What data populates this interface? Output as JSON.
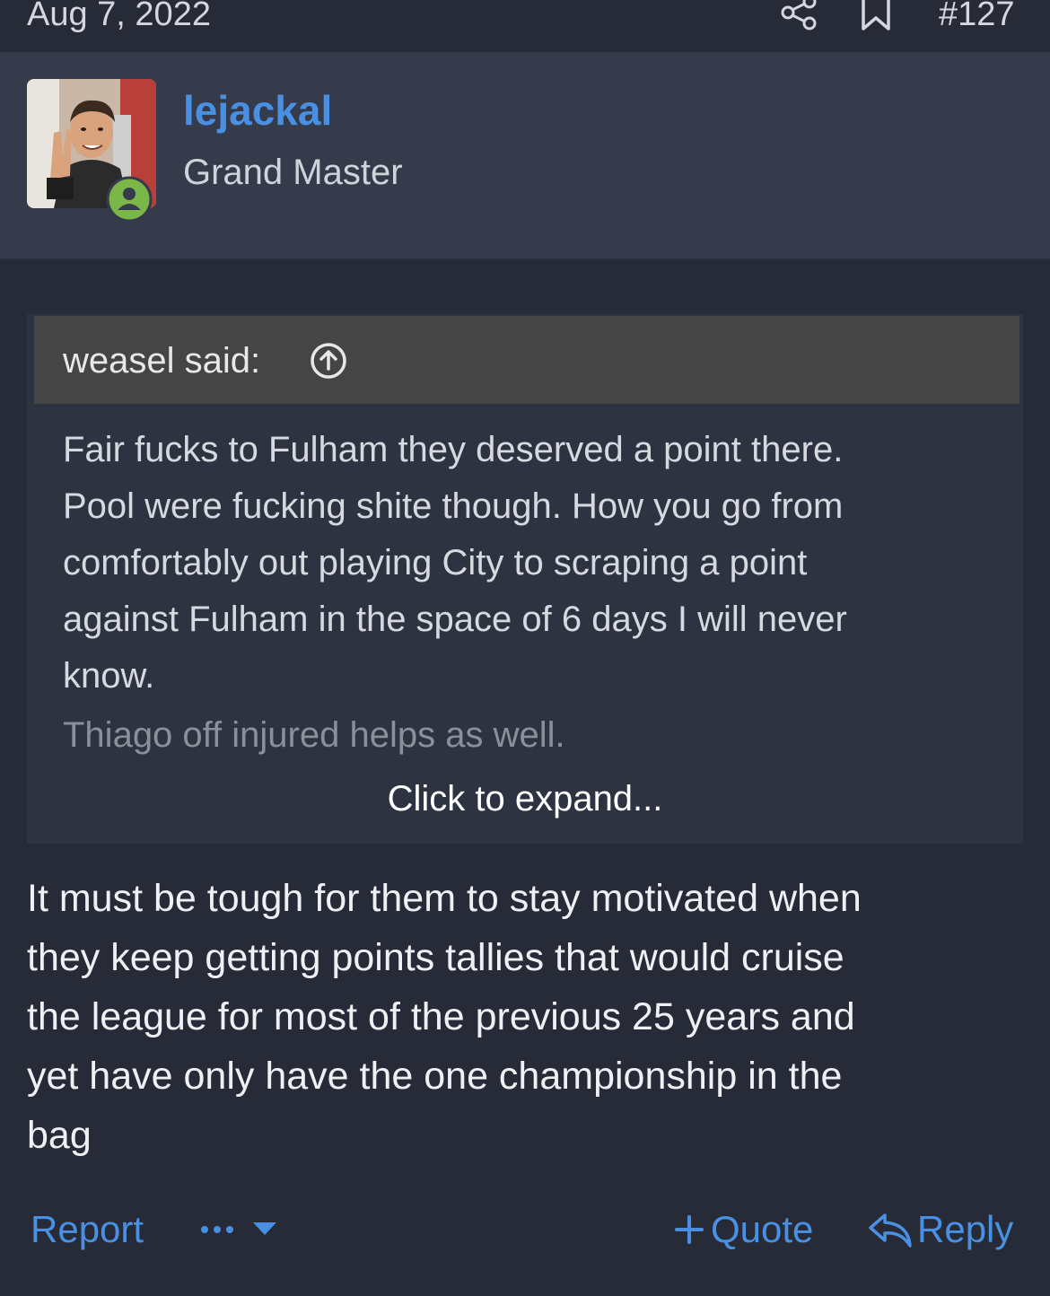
{
  "header": {
    "date": "Aug 7, 2022",
    "post_number": "#127"
  },
  "user": {
    "name": "lejackal",
    "title": "Grand Master"
  },
  "quote": {
    "author": "weasel said:",
    "lines": [
      "Fair fucks to Fulham they deserved a point there.",
      "Pool were fucking shite though. How you go from",
      "comfortably out playing City to scraping a point",
      "against Fulham in the space of 6 days I will never",
      "know."
    ],
    "faded_line": "Thiago off injured helps as well.",
    "expand_label": "Click to expand..."
  },
  "post": {
    "lines": [
      "It must be tough for them to stay motivated when",
      "they keep getting points tallies that would cruise",
      "the league for most of the previous 25 years and",
      "yet have only have the one championship in the",
      "bag"
    ]
  },
  "actions": {
    "report_label": "Report",
    "quote_label": "Quote",
    "reply_label": "Reply"
  },
  "colors": {
    "link": "#4a90e2",
    "online": "#7ab648"
  }
}
